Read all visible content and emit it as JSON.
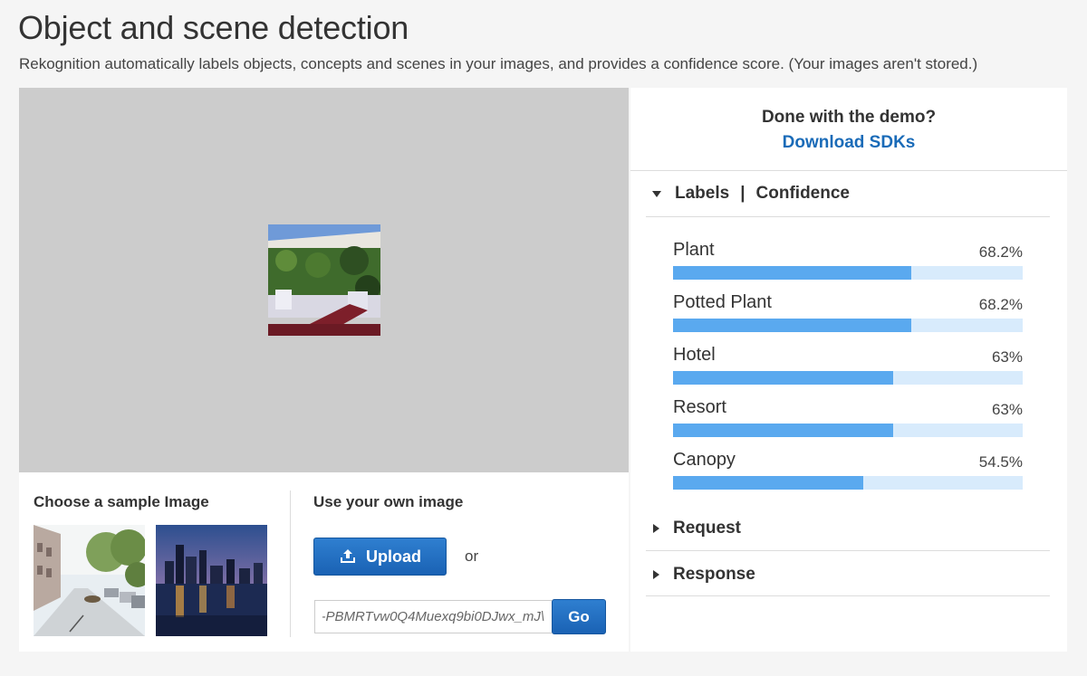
{
  "header": {
    "title": "Object and scene detection",
    "subtitle": "Rekognition automatically labels objects, concepts and scenes in your images, and provides a confidence score. (Your images aren't stored.)"
  },
  "samples": {
    "heading": "Choose a sample Image"
  },
  "own_image": {
    "heading": "Use your own image",
    "upload_label": "Upload",
    "or_text": "or",
    "url_value": "\\PBMRTvw0Q4Muexq9bi0DJwx_mJ-",
    "go_label": "Go"
  },
  "demo": {
    "question": "Done with the demo?",
    "download_link": "Download SDKs"
  },
  "sections": {
    "labels_title": "Labels",
    "separator": "|",
    "confidence_title": "Confidence",
    "request_title": "Request",
    "response_title": "Response"
  },
  "labels": [
    {
      "name": "Plant",
      "value": "68.2%",
      "fraction": 0.682
    },
    {
      "name": "Potted Plant",
      "value": "68.2%",
      "fraction": 0.682
    },
    {
      "name": "Hotel",
      "value": "63%",
      "fraction": 0.63
    },
    {
      "name": "Resort",
      "value": "63%",
      "fraction": 0.63
    },
    {
      "name": "Canopy",
      "value": "54.5%",
      "fraction": 0.545
    }
  ],
  "colors": {
    "accent": "#1a6bb8",
    "bar_fill": "#5aa9ef",
    "bar_track": "#d8ebfc",
    "button": "#1a62b4"
  }
}
